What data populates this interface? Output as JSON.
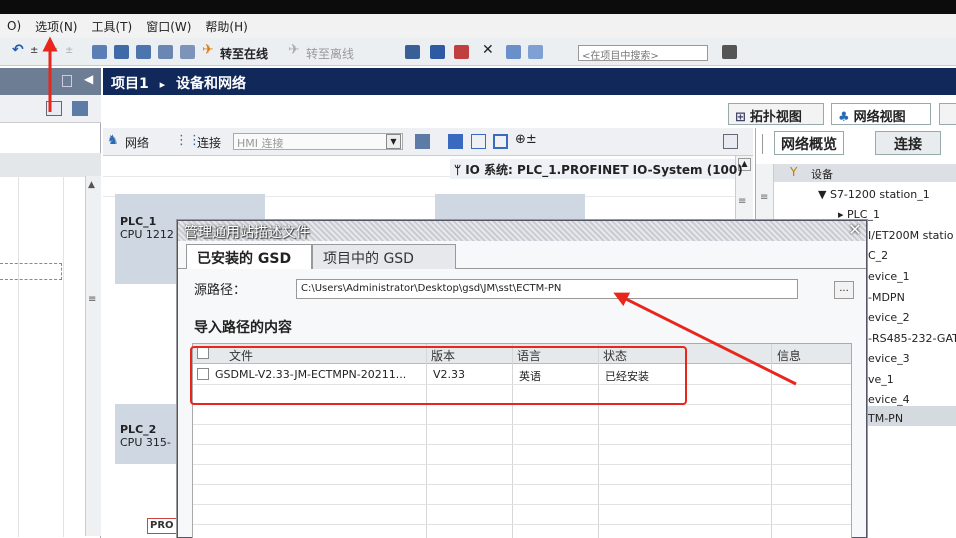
{
  "menubar": {
    "items": [
      "O)",
      "选项(N)",
      "工具(T)",
      "窗口(W)",
      "帮助(H)"
    ]
  },
  "toolbar": {
    "go_online": "转至在线",
    "go_offline": "转至离线",
    "search_placeholder": "<在项目中搜索>"
  },
  "breadcrumb": {
    "project": "项目1",
    "separator": "▸",
    "page": "设备和网络"
  },
  "view_tabs": {
    "topology": "拓扑视图",
    "network": "网络视图"
  },
  "network_toolbar": {
    "network": "网络",
    "connections": "连接",
    "hmi_connection": "HMI 连接"
  },
  "canvas": {
    "io_system": "IO 系统: PLC_1.PROFINET IO-System (100)",
    "plc1_name": "PLC_1",
    "plc1_cpu": "CPU 1212",
    "plc2_name": "PLC_2",
    "plc2_cpu": "CPU 315-",
    "pro_label": "PRO"
  },
  "right_pane": {
    "tab_overview": "网络概览",
    "tab_connections": "连接",
    "header": "设备",
    "items": [
      "▼ S7-1200 station_1",
      "▸ PLC_1",
      "I/ET200M statio",
      "C_2",
      "evice_1",
      "-MDPN",
      "evice_2",
      "-RS485-232-GAT",
      "evice_3",
      "ve_1",
      "evice_4",
      "TM-PN"
    ]
  },
  "dialog": {
    "title": "管理通用站描述文件",
    "close": "✕",
    "tab_installed": "已安装的 GSD",
    "tab_project": "项目中的 GSD",
    "source_label": "源路径：",
    "source_path": "C:\\Users\\Administrator\\Desktop\\gsd\\JM\\sst\\ECTM-PN",
    "browse": "...",
    "import_title": "导入路径的内容",
    "columns": [
      "文件",
      "版本",
      "语言",
      "状态",
      "信息"
    ],
    "rows": [
      {
        "file": "GSDML-V2.33-JM-ECTMPN-20211...",
        "version": "V2.33",
        "language": "英语",
        "status": "已经安装",
        "info": ""
      }
    ]
  },
  "colors": {
    "breadcrumb_bg": "#10285a",
    "annotation": "#e8261c",
    "left_title_bg": "#6d7d94"
  }
}
